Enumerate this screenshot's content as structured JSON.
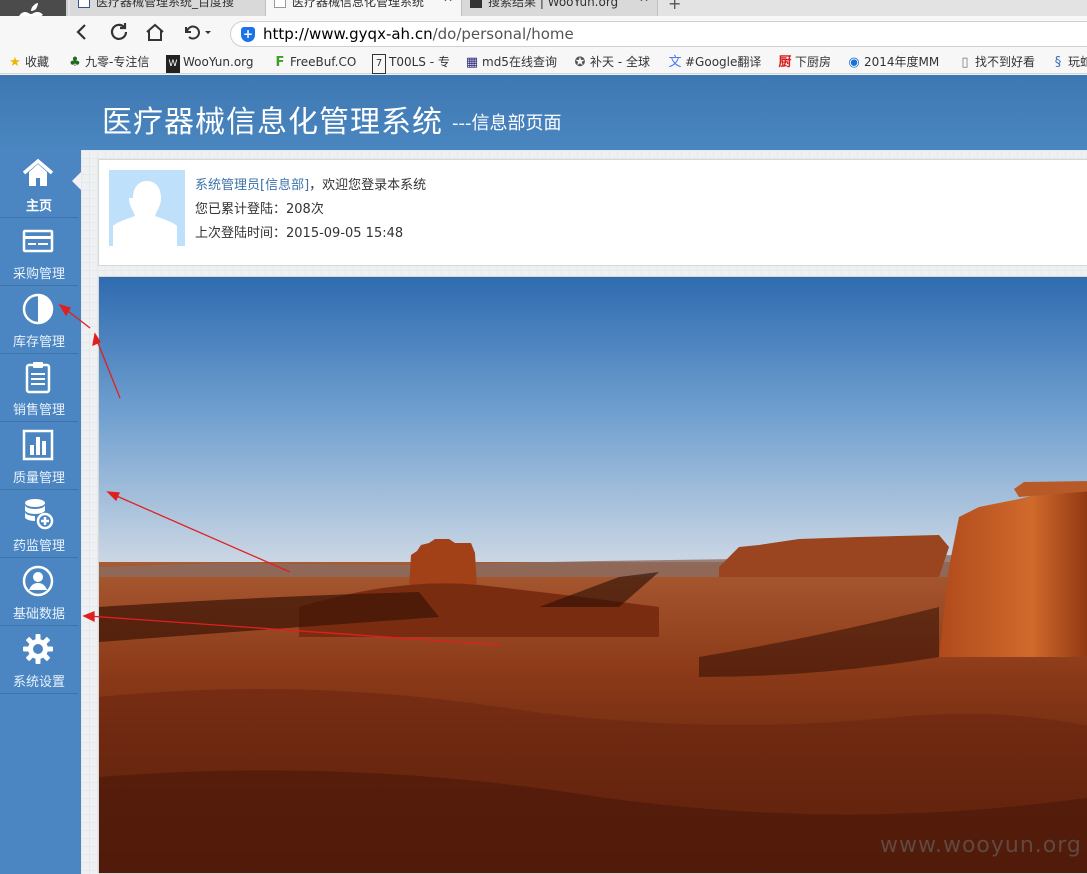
{
  "browser": {
    "tabs": [
      {
        "title": "医疗器械管理系统_百度搜"
      },
      {
        "title": "医疗器械信息化管理系统"
      },
      {
        "title": "搜索结果 | WooYun.org"
      }
    ],
    "new_tab_label": "+",
    "url_host": "http://www.gyqx-ah.cn",
    "url_path": "/do/personal/home",
    "bookmarks": [
      {
        "label": "收藏",
        "icon": "star-icon"
      },
      {
        "label": "九零-专注信",
        "icon": "tree-icon"
      },
      {
        "label": "WooYun.org",
        "icon": "wooyun-icon"
      },
      {
        "label": "FreeBuf.CO",
        "icon": "freebuf-icon"
      },
      {
        "label": "T00LS - 专",
        "icon": "tools-icon"
      },
      {
        "label": "md5在线查询",
        "icon": "grid-icon"
      },
      {
        "label": "补天 - 全球",
        "icon": "butian-icon"
      },
      {
        "label": "#Google翻译",
        "icon": "translate-icon"
      },
      {
        "label": "下厨房",
        "icon": "kitchen-icon"
      },
      {
        "label": "2014年度MM",
        "icon": "play-icon"
      },
      {
        "label": "找不到好看",
        "icon": "page-icon"
      },
      {
        "label": "玩蛇",
        "icon": "python-icon"
      }
    ]
  },
  "header": {
    "title": "医疗器械信息化管理系统",
    "subtitle": "---信息部页面"
  },
  "sidebar": {
    "items": [
      {
        "label": "主页",
        "icon": "home-icon"
      },
      {
        "label": "采购管理",
        "icon": "card-icon"
      },
      {
        "label": "库存管理",
        "icon": "pie-icon"
      },
      {
        "label": "销售管理",
        "icon": "clipboard-icon"
      },
      {
        "label": "质量管理",
        "icon": "bar-chart-icon"
      },
      {
        "label": "药监管理",
        "icon": "database-add-icon"
      },
      {
        "label": "基础数据",
        "icon": "user-circle-icon"
      },
      {
        "label": "系统设置",
        "icon": "gear-icon"
      }
    ]
  },
  "profile": {
    "user": "系统管理员[信息部]",
    "welcome": "，欢迎您登录本系统",
    "login_count": "您已累计登陆：208次",
    "last_login": "上次登陆时间：2015-09-05 15:48"
  },
  "watermark": "www.wooyun.org",
  "colors": {
    "header_bg": "#4a86c0",
    "sidebar_bg": "#4b86c2",
    "annotation_arrow": "#e02020"
  }
}
